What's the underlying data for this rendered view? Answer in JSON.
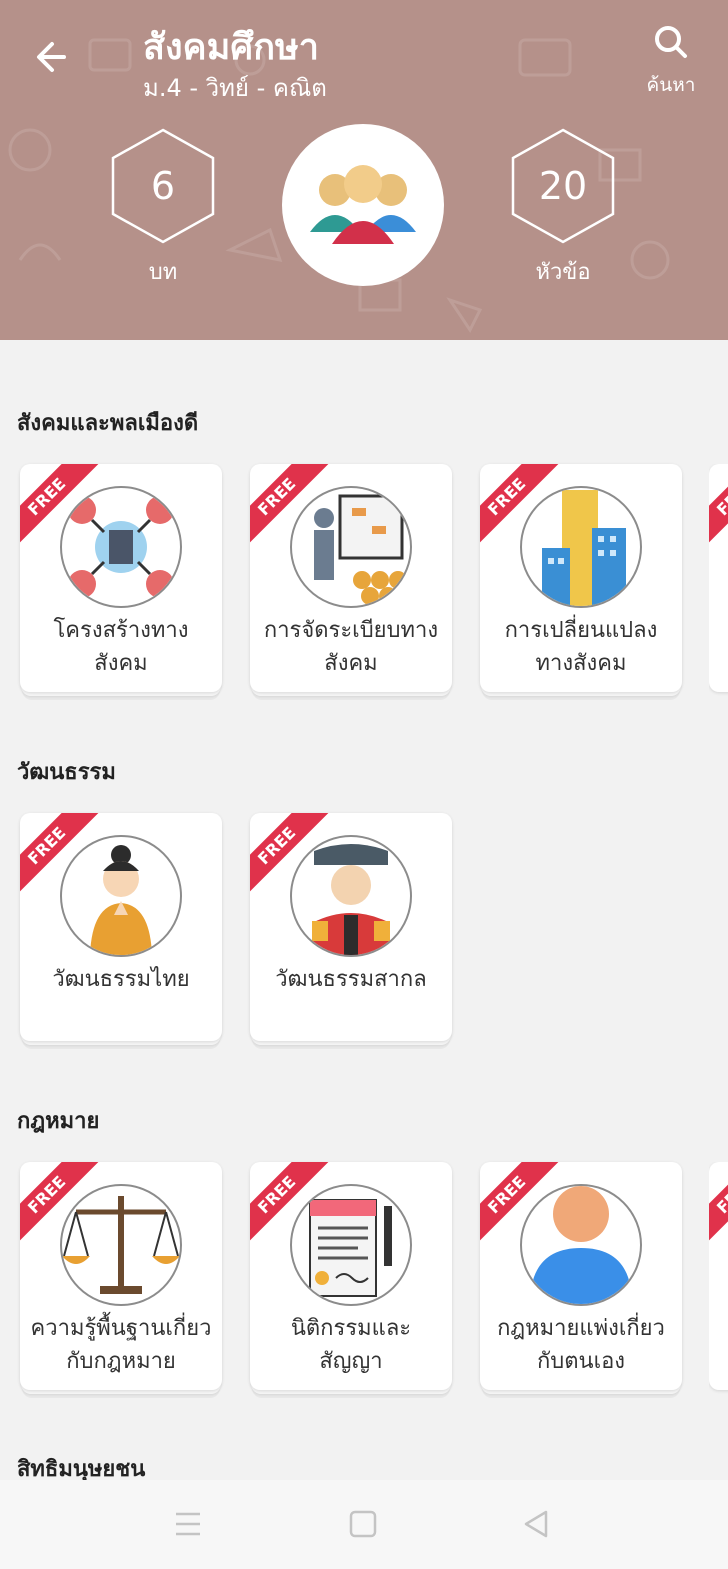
{
  "header": {
    "title": "สังคมศึกษา",
    "subtitle": "ม.4 - วิทย์ - คณิต",
    "search_label": "ค้นหา",
    "chapters_count": "6",
    "chapters_label": "บท",
    "topics_count": "20",
    "topics_label": "หัวข้อ",
    "background_color": "#b5918a"
  },
  "badge": "FREE",
  "sections": [
    {
      "title": "สังคมและพลเมืองดี",
      "cards": [
        {
          "label": "โครงสร้างทาง\nสังคม",
          "icon": "social-network-icon"
        },
        {
          "label": "การจัดระเบียบทาง\nสังคม",
          "icon": "presentation-icon"
        },
        {
          "label": "การเปลี่ยนแปลง\nทางสังคม",
          "icon": "city-buildings-icon"
        }
      ]
    },
    {
      "title": "วัฒนธรรม",
      "cards": [
        {
          "label": "วัฒนธรรมไทย",
          "icon": "thai-dancer-icon"
        },
        {
          "label": "วัฒนธรรมสากล",
          "icon": "matador-icon"
        }
      ]
    },
    {
      "title": "กฎหมาย",
      "cards": [
        {
          "label": "ความรู้พื้นฐานเกี่ยว\nกับกฎหมาย",
          "icon": "justice-scale-icon"
        },
        {
          "label": "นิติกรรมและ\nสัญญา",
          "icon": "contract-document-icon"
        },
        {
          "label": "กฎหมายแพ่งเกี่ยว\nกับตนเอง",
          "icon": "person-icon"
        }
      ]
    },
    {
      "title": "สิทธิมนุษยชน",
      "cards": []
    }
  ],
  "system_nav": {
    "menu_icon": "menu-icon",
    "home_icon": "square-home-icon",
    "back_icon": "triangle-back-icon"
  }
}
